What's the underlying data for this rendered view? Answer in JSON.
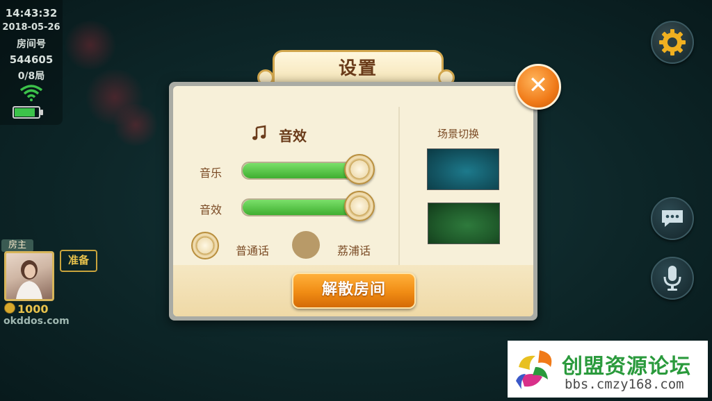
{
  "status": {
    "time": "14:43:32",
    "date": "2018-05-26",
    "room_label": "房间号",
    "room_number": "544605",
    "round": "0/8局",
    "battery_level": 0.85
  },
  "player": {
    "host_tag": "房主",
    "ready_label": "准备",
    "coins": "1000",
    "site": "okddos.com"
  },
  "dialog": {
    "title": "设置",
    "audio": {
      "header": "音效",
      "music_label": "音乐",
      "music_level": 1.0,
      "sound_label": "音效",
      "sound_level": 1.0
    },
    "dialect": {
      "option1": "普通话",
      "option2": "荔浦话",
      "selected": "普通话"
    },
    "scene": {
      "header": "场景切换"
    },
    "dismiss_button": "解散房间"
  },
  "watermark": {
    "title": "创盟资源论坛",
    "url": "bbs.cmzy168.com"
  },
  "colors": {
    "accent_orange": "#f08c14",
    "slider_green": "#3fae30",
    "dialog_bg": "#f7f0d9",
    "title_brown": "#6a3b1a"
  }
}
